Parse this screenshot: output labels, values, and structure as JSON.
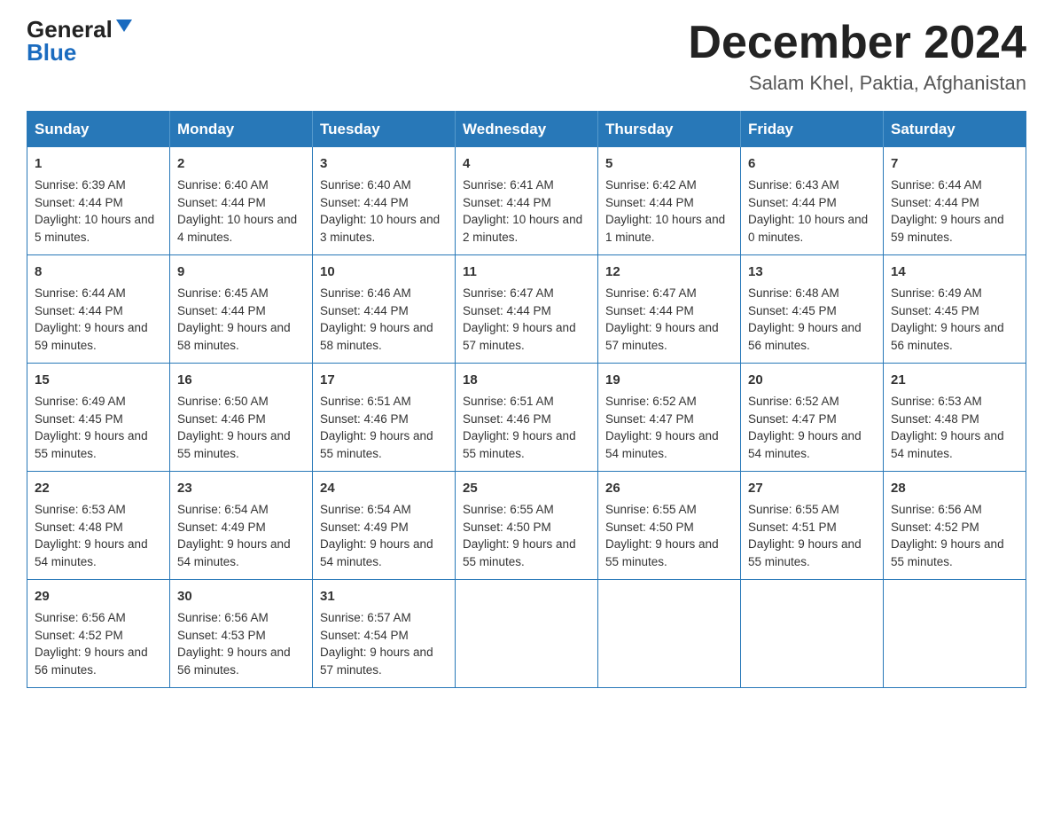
{
  "header": {
    "logo_general": "General",
    "logo_blue": "Blue",
    "month_title": "December 2024",
    "location": "Salam Khel, Paktia, Afghanistan"
  },
  "days_of_week": [
    "Sunday",
    "Monday",
    "Tuesday",
    "Wednesday",
    "Thursday",
    "Friday",
    "Saturday"
  ],
  "weeks": [
    [
      {
        "day": "1",
        "sunrise": "Sunrise: 6:39 AM",
        "sunset": "Sunset: 4:44 PM",
        "daylight": "Daylight: 10 hours and 5 minutes."
      },
      {
        "day": "2",
        "sunrise": "Sunrise: 6:40 AM",
        "sunset": "Sunset: 4:44 PM",
        "daylight": "Daylight: 10 hours and 4 minutes."
      },
      {
        "day": "3",
        "sunrise": "Sunrise: 6:40 AM",
        "sunset": "Sunset: 4:44 PM",
        "daylight": "Daylight: 10 hours and 3 minutes."
      },
      {
        "day": "4",
        "sunrise": "Sunrise: 6:41 AM",
        "sunset": "Sunset: 4:44 PM",
        "daylight": "Daylight: 10 hours and 2 minutes."
      },
      {
        "day": "5",
        "sunrise": "Sunrise: 6:42 AM",
        "sunset": "Sunset: 4:44 PM",
        "daylight": "Daylight: 10 hours and 1 minute."
      },
      {
        "day": "6",
        "sunrise": "Sunrise: 6:43 AM",
        "sunset": "Sunset: 4:44 PM",
        "daylight": "Daylight: 10 hours and 0 minutes."
      },
      {
        "day": "7",
        "sunrise": "Sunrise: 6:44 AM",
        "sunset": "Sunset: 4:44 PM",
        "daylight": "Daylight: 9 hours and 59 minutes."
      }
    ],
    [
      {
        "day": "8",
        "sunrise": "Sunrise: 6:44 AM",
        "sunset": "Sunset: 4:44 PM",
        "daylight": "Daylight: 9 hours and 59 minutes."
      },
      {
        "day": "9",
        "sunrise": "Sunrise: 6:45 AM",
        "sunset": "Sunset: 4:44 PM",
        "daylight": "Daylight: 9 hours and 58 minutes."
      },
      {
        "day": "10",
        "sunrise": "Sunrise: 6:46 AM",
        "sunset": "Sunset: 4:44 PM",
        "daylight": "Daylight: 9 hours and 58 minutes."
      },
      {
        "day": "11",
        "sunrise": "Sunrise: 6:47 AM",
        "sunset": "Sunset: 4:44 PM",
        "daylight": "Daylight: 9 hours and 57 minutes."
      },
      {
        "day": "12",
        "sunrise": "Sunrise: 6:47 AM",
        "sunset": "Sunset: 4:44 PM",
        "daylight": "Daylight: 9 hours and 57 minutes."
      },
      {
        "day": "13",
        "sunrise": "Sunrise: 6:48 AM",
        "sunset": "Sunset: 4:45 PM",
        "daylight": "Daylight: 9 hours and 56 minutes."
      },
      {
        "day": "14",
        "sunrise": "Sunrise: 6:49 AM",
        "sunset": "Sunset: 4:45 PM",
        "daylight": "Daylight: 9 hours and 56 minutes."
      }
    ],
    [
      {
        "day": "15",
        "sunrise": "Sunrise: 6:49 AM",
        "sunset": "Sunset: 4:45 PM",
        "daylight": "Daylight: 9 hours and 55 minutes."
      },
      {
        "day": "16",
        "sunrise": "Sunrise: 6:50 AM",
        "sunset": "Sunset: 4:46 PM",
        "daylight": "Daylight: 9 hours and 55 minutes."
      },
      {
        "day": "17",
        "sunrise": "Sunrise: 6:51 AM",
        "sunset": "Sunset: 4:46 PM",
        "daylight": "Daylight: 9 hours and 55 minutes."
      },
      {
        "day": "18",
        "sunrise": "Sunrise: 6:51 AM",
        "sunset": "Sunset: 4:46 PM",
        "daylight": "Daylight: 9 hours and 55 minutes."
      },
      {
        "day": "19",
        "sunrise": "Sunrise: 6:52 AM",
        "sunset": "Sunset: 4:47 PM",
        "daylight": "Daylight: 9 hours and 54 minutes."
      },
      {
        "day": "20",
        "sunrise": "Sunrise: 6:52 AM",
        "sunset": "Sunset: 4:47 PM",
        "daylight": "Daylight: 9 hours and 54 minutes."
      },
      {
        "day": "21",
        "sunrise": "Sunrise: 6:53 AM",
        "sunset": "Sunset: 4:48 PM",
        "daylight": "Daylight: 9 hours and 54 minutes."
      }
    ],
    [
      {
        "day": "22",
        "sunrise": "Sunrise: 6:53 AM",
        "sunset": "Sunset: 4:48 PM",
        "daylight": "Daylight: 9 hours and 54 minutes."
      },
      {
        "day": "23",
        "sunrise": "Sunrise: 6:54 AM",
        "sunset": "Sunset: 4:49 PM",
        "daylight": "Daylight: 9 hours and 54 minutes."
      },
      {
        "day": "24",
        "sunrise": "Sunrise: 6:54 AM",
        "sunset": "Sunset: 4:49 PM",
        "daylight": "Daylight: 9 hours and 54 minutes."
      },
      {
        "day": "25",
        "sunrise": "Sunrise: 6:55 AM",
        "sunset": "Sunset: 4:50 PM",
        "daylight": "Daylight: 9 hours and 55 minutes."
      },
      {
        "day": "26",
        "sunrise": "Sunrise: 6:55 AM",
        "sunset": "Sunset: 4:50 PM",
        "daylight": "Daylight: 9 hours and 55 minutes."
      },
      {
        "day": "27",
        "sunrise": "Sunrise: 6:55 AM",
        "sunset": "Sunset: 4:51 PM",
        "daylight": "Daylight: 9 hours and 55 minutes."
      },
      {
        "day": "28",
        "sunrise": "Sunrise: 6:56 AM",
        "sunset": "Sunset: 4:52 PM",
        "daylight": "Daylight: 9 hours and 55 minutes."
      }
    ],
    [
      {
        "day": "29",
        "sunrise": "Sunrise: 6:56 AM",
        "sunset": "Sunset: 4:52 PM",
        "daylight": "Daylight: 9 hours and 56 minutes."
      },
      {
        "day": "30",
        "sunrise": "Sunrise: 6:56 AM",
        "sunset": "Sunset: 4:53 PM",
        "daylight": "Daylight: 9 hours and 56 minutes."
      },
      {
        "day": "31",
        "sunrise": "Sunrise: 6:57 AM",
        "sunset": "Sunset: 4:54 PM",
        "daylight": "Daylight: 9 hours and 57 minutes."
      },
      null,
      null,
      null,
      null
    ]
  ]
}
